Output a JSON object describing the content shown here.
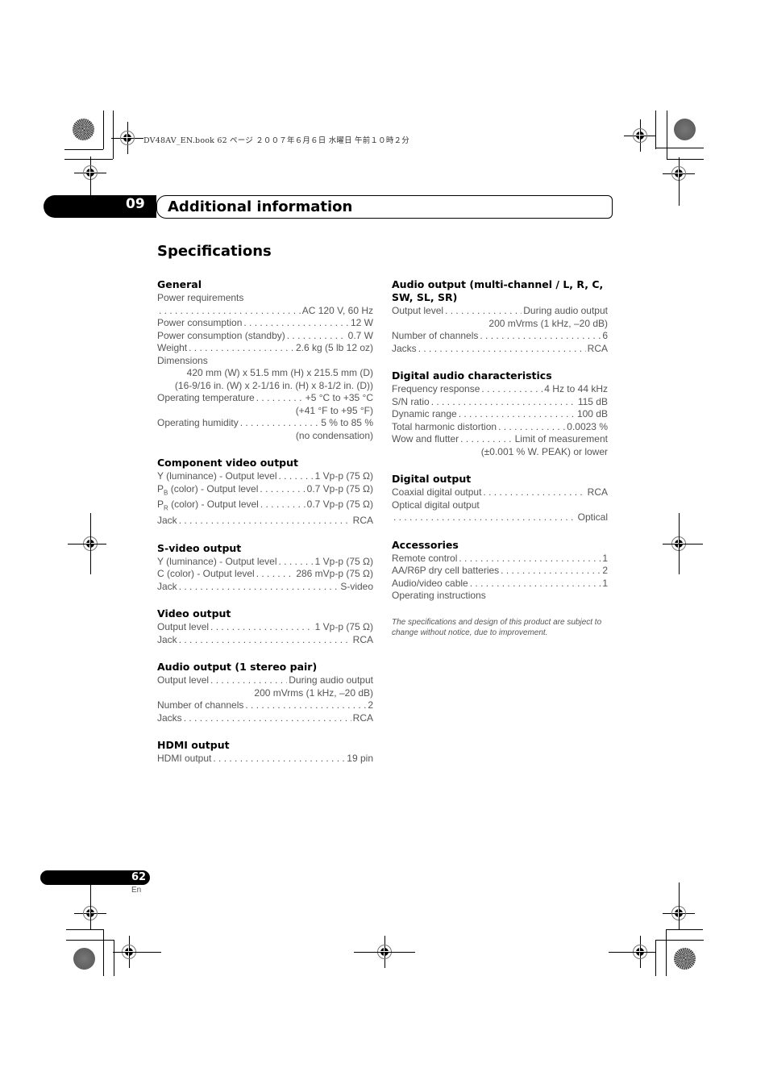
{
  "print_header": "DV48AV_EN.book  62 ページ  ２００７年６月６日  水曜日  午前１０時２分",
  "chapter": {
    "number": "09",
    "title": "Additional information"
  },
  "page_title": "Specifications",
  "left_column": [
    {
      "heading": "General",
      "rows": [
        {
          "label": "Power requirements",
          "value": ""
        },
        {
          "label": "",
          "value": "AC 120 V, 60 Hz"
        },
        {
          "label": "Power consumption",
          "value": "12 W"
        },
        {
          "label": "Power consumption (standby)",
          "value": "0.7 W"
        },
        {
          "label": "Weight",
          "value": "2.6 kg (5 lb 12 oz)"
        },
        {
          "label": "Dimensions",
          "value": ""
        },
        {
          "cont": "420 mm (W) x 51.5 mm (H) x 215.5 mm (D)"
        },
        {
          "cont": "(16-9/16 in. (W) x 2-1/16 in. (H) x 8-1/2 in. (D))"
        },
        {
          "label": "Operating temperature",
          "value": "+5 °C to +35 °C"
        },
        {
          "cont": "(+41 °F to +95 °F)"
        },
        {
          "label": "Operating humidity",
          "value": "5 % to 85 %"
        },
        {
          "cont": "(no condensation)"
        }
      ]
    },
    {
      "heading": "Component video output",
      "rows": [
        {
          "label": "Y (luminance) - Output level",
          "value": "1 Vp-p (75 Ω)"
        },
        {
          "label": "P_B (color) - Output level",
          "value": "0.7 Vp-p (75 Ω)"
        },
        {
          "label": "P_R (color) - Output level",
          "value": "0.7 Vp-p (75 Ω)"
        },
        {
          "label": "Jack",
          "value": "RCA"
        }
      ]
    },
    {
      "heading": "S-video output",
      "rows": [
        {
          "label": "Y (luminance) - Output level",
          "value": "1 Vp-p (75 Ω)"
        },
        {
          "label": "C (color) - Output level",
          "value": "286 mVp-p (75 Ω)"
        },
        {
          "label": "Jack",
          "value": "S-video"
        }
      ]
    },
    {
      "heading": "Video output",
      "rows": [
        {
          "label": "Output level",
          "value": "1 Vp-p (75 Ω)"
        },
        {
          "label": "Jack",
          "value": "RCA"
        }
      ]
    },
    {
      "heading": "Audio output (1 stereo pair)",
      "rows": [
        {
          "label": "Output level",
          "value": "During audio output"
        },
        {
          "cont": "200 mVrms (1 kHz, –20 dB)"
        },
        {
          "label": "Number of channels",
          "value": "2"
        },
        {
          "label": "Jacks",
          "value": "RCA"
        }
      ]
    },
    {
      "heading": "HDMI output",
      "rows": [
        {
          "label": "HDMI output",
          "value": "19 pin"
        }
      ]
    }
  ],
  "right_column": [
    {
      "heading": "Audio output (multi-channel / L, R, C, SW, SL, SR)",
      "rows": [
        {
          "label": "Output level",
          "value": "During audio output"
        },
        {
          "cont": "200 mVrms (1 kHz, –20 dB)"
        },
        {
          "label": "Number of channels",
          "value": "6"
        },
        {
          "label": "Jacks",
          "value": "RCA"
        }
      ]
    },
    {
      "heading": "Digital audio characteristics",
      "rows": [
        {
          "label": "Frequency response",
          "value": "4 Hz to 44 kHz"
        },
        {
          "label": "S/N ratio",
          "value": "115 dB"
        },
        {
          "label": "Dynamic range",
          "value": "100 dB"
        },
        {
          "label": "Total harmonic distortion",
          "value": "0.0023 %"
        },
        {
          "label": "Wow and flutter",
          "value": "Limit of measurement"
        },
        {
          "cont": "(±0.001 % W. PEAK) or lower"
        }
      ]
    },
    {
      "heading": "Digital output",
      "rows": [
        {
          "label": "Coaxial digital output",
          "value": "RCA"
        },
        {
          "label": "Optical digital output",
          "value": ""
        },
        {
          "label": "",
          "value": "Optical"
        }
      ]
    },
    {
      "heading": "Accessories",
      "rows": [
        {
          "label": "Remote control",
          "value": "1"
        },
        {
          "label": "AA/R6P dry cell batteries",
          "value": "2"
        },
        {
          "label": "Audio/video cable",
          "value": "1"
        },
        {
          "label": "Operating instructions",
          "value": ""
        }
      ]
    }
  ],
  "footnote": "The specifications and design of this product are subject to change without notice, due to improvement.",
  "footer": {
    "page_number": "62",
    "language": "En"
  }
}
